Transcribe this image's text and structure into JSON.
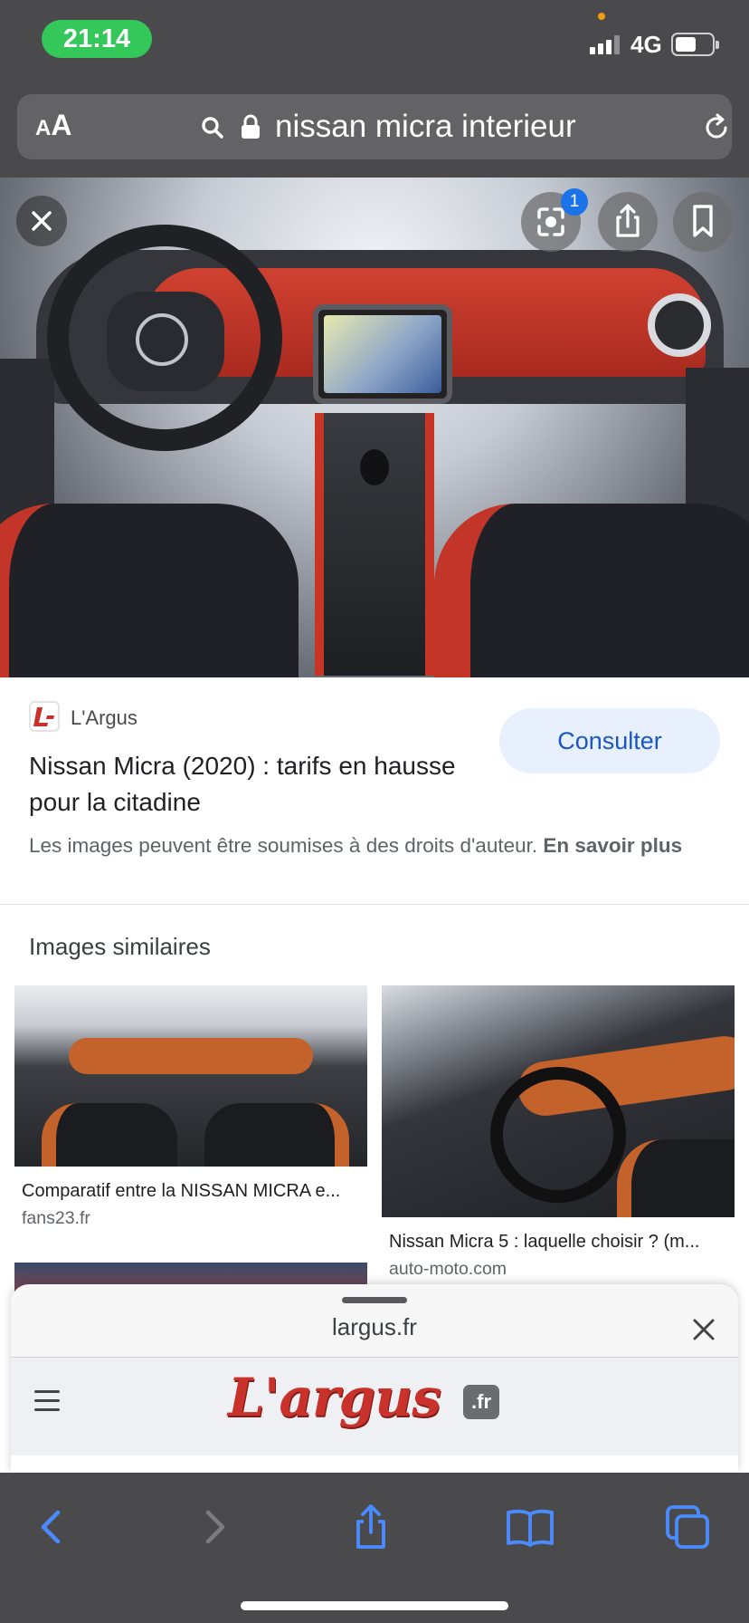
{
  "status_bar": {
    "time": "21:14",
    "network": "4G"
  },
  "address_bar": {
    "aa_small": "A",
    "aa_big": "A",
    "url": "nissan micra interieur"
  },
  "hero": {
    "lens_badge": "1"
  },
  "result": {
    "source": "L'Argus",
    "headline": "Nissan Micra (2020) : tarifs en hausse pour la citadine",
    "consult_label": "Consulter",
    "copyright_text": "Les images peuvent être soumises à des droits d'auteur. ",
    "learn_more": "En savoir plus"
  },
  "similar": {
    "title": "Images similaires",
    "items": [
      {
        "title": "Comparatif entre la NISSAN MICRA e...",
        "site": "fans23.fr"
      },
      {
        "title": "Nissan Micra 5 : laquelle choisir ? (m...",
        "site": "auto-moto.com"
      }
    ]
  },
  "preview_sheet": {
    "domain": "largus.fr",
    "logo_text": "L'argus",
    "logo_suffix": ".fr"
  },
  "colors": {
    "accent_blue": "#1a73e8",
    "status_green": "#34c759",
    "toolbar_icon_blue": "#4a8cff"
  }
}
